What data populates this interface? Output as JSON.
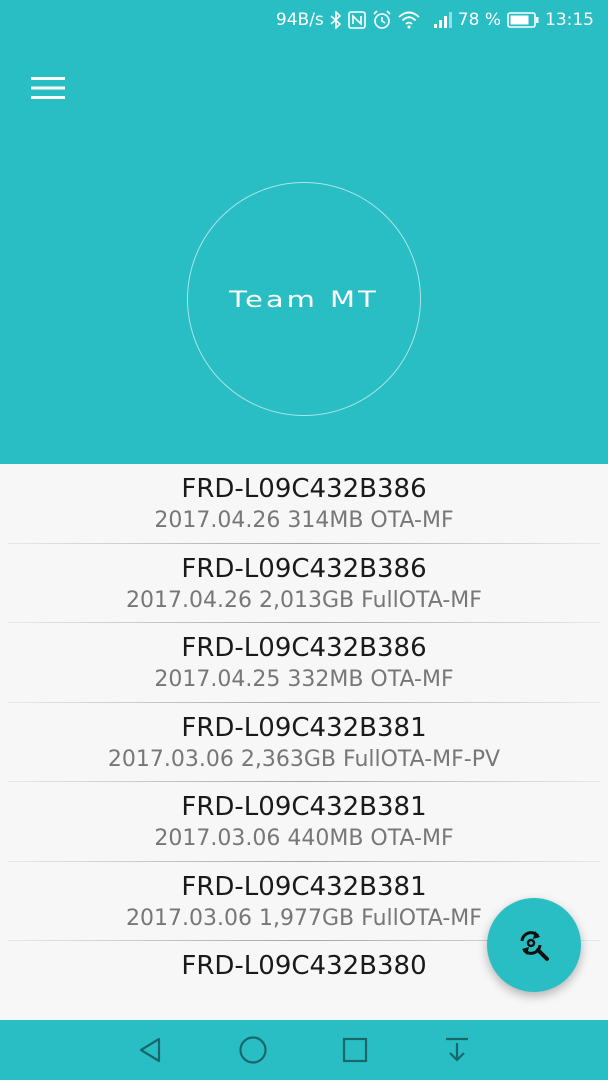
{
  "statusbar": {
    "speed": "94B/s",
    "battery": "78 %",
    "time": "13:15",
    "icons": [
      "bluetooth-icon",
      "nfc-icon",
      "alarm-icon",
      "wifi-icon",
      "signal-icon",
      "battery-icon"
    ]
  },
  "header": {
    "logo": "Team MT",
    "accent_color": "#29bec4"
  },
  "firmware_list": [
    {
      "model": "FRD-L09C432B386",
      "details": "2017.04.26 314MB OTA-MF"
    },
    {
      "model": "FRD-L09C432B386",
      "details": "2017.04.26 2,013GB FullOTA-MF"
    },
    {
      "model": "FRD-L09C432B386",
      "details": "2017.04.25 332MB OTA-MF"
    },
    {
      "model": "FRD-L09C432B381",
      "details": "2017.03.06 2,363GB FullOTA-MF-PV"
    },
    {
      "model": "FRD-L09C432B381",
      "details": "2017.03.06 440MB OTA-MF"
    },
    {
      "model": "FRD-L09C432B381",
      "details": "2017.03.06 1,977GB FullOTA-MF"
    },
    {
      "model": "FRD-L09C432B380",
      "details": ""
    }
  ],
  "fab": {
    "icon": "refresh-search-icon"
  },
  "navbar": {
    "icons": [
      "back-icon",
      "home-icon",
      "recents-icon",
      "notification-pull-icon"
    ]
  }
}
